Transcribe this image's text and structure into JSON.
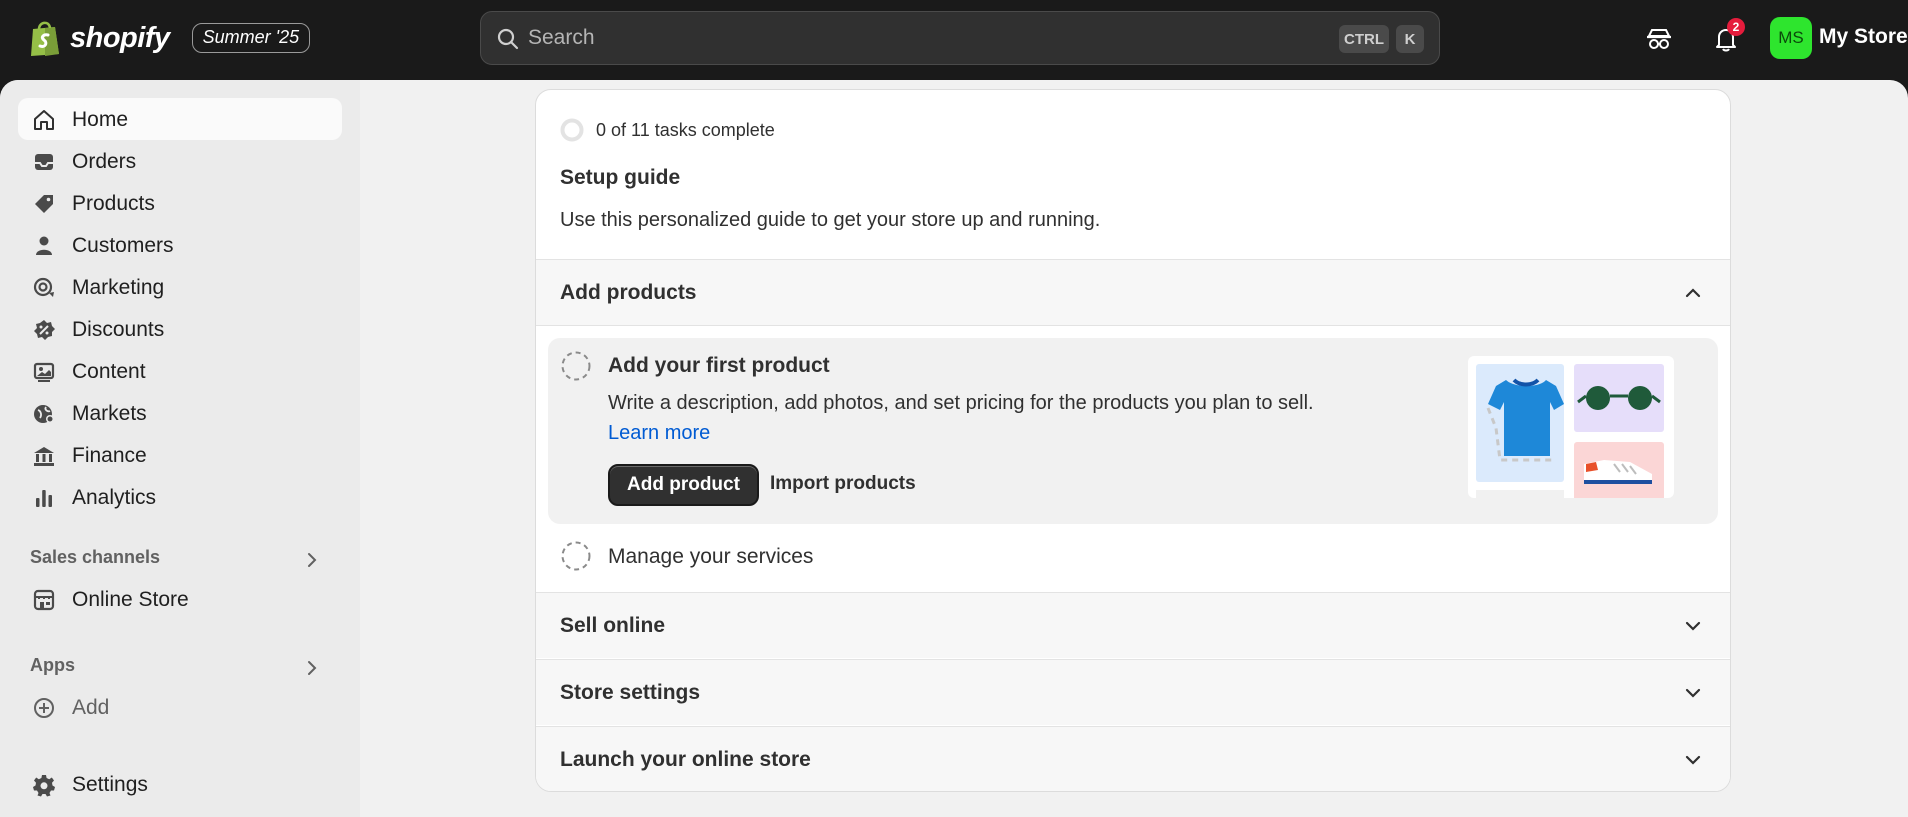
{
  "brand": {
    "name": "shopify",
    "release_badge": "Summer '25"
  },
  "search": {
    "placeholder": "Search",
    "shortcut_ctrl": "CTRL",
    "shortcut_key": "K"
  },
  "header": {
    "notification_count": "2",
    "avatar_initials": "MS",
    "store_name": "My Store"
  },
  "sidebar": {
    "items": [
      {
        "label": "Home",
        "icon": "home-icon",
        "active": true
      },
      {
        "label": "Orders",
        "icon": "inbox-icon"
      },
      {
        "label": "Products",
        "icon": "tag-icon"
      },
      {
        "label": "Customers",
        "icon": "person-icon"
      },
      {
        "label": "Marketing",
        "icon": "target-icon"
      },
      {
        "label": "Discounts",
        "icon": "discount-icon"
      },
      {
        "label": "Content",
        "icon": "image-icon"
      },
      {
        "label": "Markets",
        "icon": "globe-icon"
      },
      {
        "label": "Finance",
        "icon": "bank-icon"
      },
      {
        "label": "Analytics",
        "icon": "bar-chart-icon"
      }
    ],
    "sales_channels": {
      "heading": "Sales channels",
      "items": [
        {
          "label": "Online Store",
          "icon": "storefront-icon"
        }
      ]
    },
    "apps": {
      "heading": "Apps",
      "add_label": "Add"
    },
    "settings_label": "Settings"
  },
  "setup_guide": {
    "progress_text": "0 of 11 tasks complete",
    "progress": {
      "completed": 0,
      "total": 11
    },
    "title": "Setup guide",
    "description": "Use this personalized guide to get your store up and running.",
    "sections": [
      {
        "title": "Add products",
        "expanded": true,
        "tasks": [
          {
            "title": "Add your first product",
            "description": "Write a description, add photos, and set pricing for the products you plan to sell.",
            "link_text": "Learn more",
            "primary_action": "Add product",
            "secondary_action": "Import products"
          },
          {
            "title": "Manage your services"
          }
        ]
      },
      {
        "title": "Sell online",
        "expanded": false
      },
      {
        "title": "Store settings",
        "expanded": false
      },
      {
        "title": "Launch your online store",
        "expanded": false
      }
    ]
  },
  "colors": {
    "topbar": "#1a1a1a",
    "accent_link": "#005bd3",
    "avatar": "#2ee52e",
    "badge": "#e51c3c",
    "primary_button": "#303030"
  }
}
